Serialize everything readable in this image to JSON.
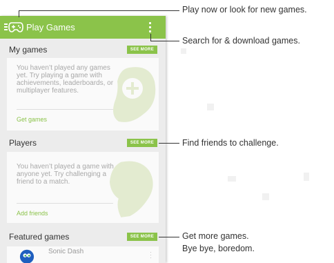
{
  "app": {
    "title": "Play Games"
  },
  "sections": {
    "my_games": {
      "title": "My games",
      "see_more": "SEE MORE",
      "body": "You haven’t played any games yet. Try playing a game with achievements, leaderboards, or multiplayer features.",
      "link": "Get games"
    },
    "players": {
      "title": "Players",
      "see_more": "SEE MORE",
      "body": "You haven’t played a game with anyone yet. Try challenging a friend to a match.",
      "link": "Add friends"
    },
    "featured": {
      "title": "Featured games",
      "see_more": "SEE MORE",
      "first_item": "Sonic Dash"
    }
  },
  "callouts": {
    "play_now": "Play now or look for new games.",
    "search": "Search for & download games.",
    "friends": "Find friends to challenge.",
    "more_games_1": "Get more games.",
    "more_games_2": "Bye bye, boredom."
  },
  "colors": {
    "accent": "#8bc34a",
    "background": "#ececec",
    "card": "#fafafa"
  },
  "icons": [
    "menu-icon",
    "game-controller-icon",
    "overflow-menu-icon",
    "plus-icon",
    "controller-art-icon",
    "sonic-thumbnail-icon"
  ]
}
